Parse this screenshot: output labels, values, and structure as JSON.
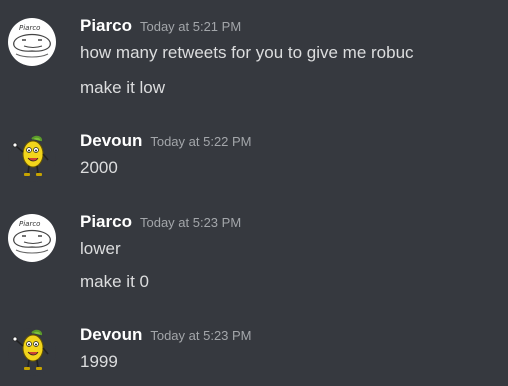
{
  "messages": [
    {
      "username": "Piarco",
      "timestamp": "Today at 5:21 PM",
      "avatar_icon": "sketch-face-icon",
      "avatar_caption": "Piarco",
      "lines": [
        "how many retweets for you to give me robuc",
        "make it low"
      ]
    },
    {
      "username": "Devoun",
      "timestamp": "Today at 5:22 PM",
      "avatar_icon": "lemon-mascot-icon",
      "lines": [
        "2000"
      ]
    },
    {
      "username": "Piarco",
      "timestamp": "Today at 5:23 PM",
      "avatar_icon": "sketch-face-icon",
      "avatar_caption": "Piarco",
      "lines": [
        "lower",
        "make it 0"
      ]
    },
    {
      "username": "Devoun",
      "timestamp": "Today at 5:23 PM",
      "avatar_icon": "lemon-mascot-icon",
      "lines": [
        "1999"
      ]
    }
  ],
  "colors": {
    "background": "#36393f",
    "username": "#ffffff",
    "timestamp": "#a3a6aa",
    "message_text": "#dcddde"
  }
}
